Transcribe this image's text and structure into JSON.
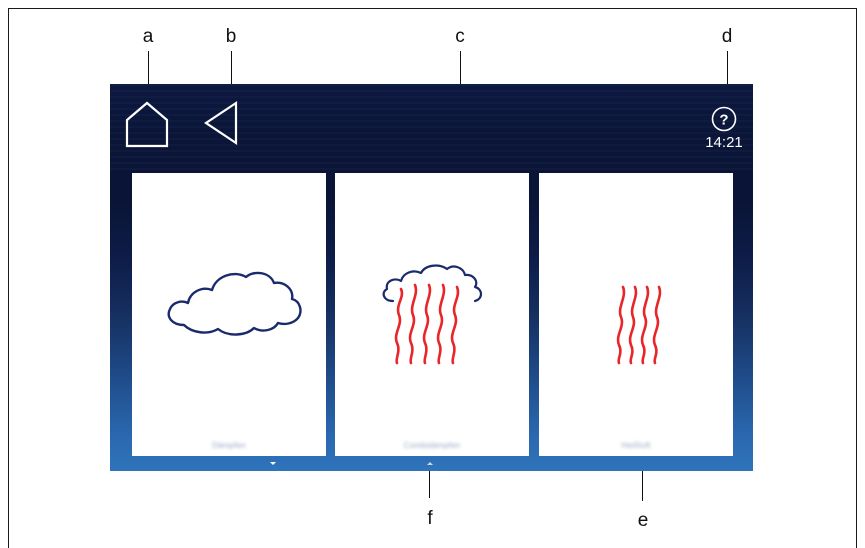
{
  "callouts": {
    "a": "a",
    "b": "b",
    "c": "c",
    "d": "d",
    "e": "e",
    "f": "f"
  },
  "status_bar": {
    "time": "14:21",
    "help_symbol": "?"
  },
  "icons": {
    "home": "home-icon",
    "back": "back-triangle-icon",
    "help": "help-circle-icon",
    "steam": "cloud-icon",
    "combi_steam": "cloud-with-heat-waves-icon",
    "hot_air": "heat-waves-icon"
  },
  "cards": [
    {
      "label": "Dämpfen",
      "icon": "cloud-icon"
    },
    {
      "label": "Combidämpfen",
      "icon": "cloud-with-heat-waves-icon"
    },
    {
      "label": "Heißluft",
      "icon": "heat-waves-icon"
    }
  ],
  "colors": {
    "screen_top": "#0a1436",
    "screen_bottom": "#2f74bb",
    "cloud_stroke": "#1a2a6c",
    "heat_wave": "#e8262a",
    "card_bg": "#ffffff"
  }
}
